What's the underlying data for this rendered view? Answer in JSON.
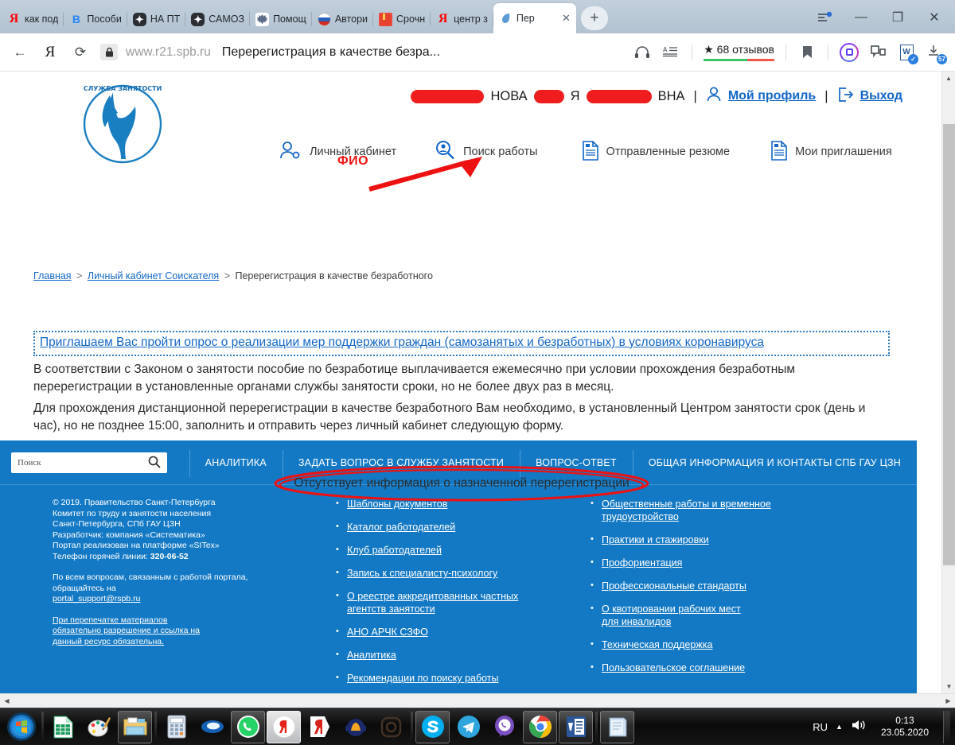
{
  "browser": {
    "tabs": [
      {
        "title": "как под",
        "favicon": "yandex-icon",
        "active": false
      },
      {
        "title": "Пособи",
        "favicon": "vk-icon",
        "active": false
      },
      {
        "title": "НА ПТ",
        "favicon": "gosuslugi-icon",
        "active": false
      },
      {
        "title": "САМОЗ",
        "favicon": "gosuslugi-icon",
        "active": false
      },
      {
        "title": "Помощ",
        "favicon": "gerb-icon",
        "active": false
      },
      {
        "title": "Автори",
        "favicon": "flag-icon",
        "active": false
      },
      {
        "title": "Срочн",
        "favicon": "book-icon",
        "active": false
      },
      {
        "title": "центр з",
        "favicon": "yandex-icon",
        "active": false
      },
      {
        "title": "Пер",
        "favicon": "browser-icon",
        "active": true
      }
    ],
    "new_tab_label": "+",
    "window_controls": {
      "sync": "sync-icon",
      "minimize": "—",
      "maximize": "❐",
      "close": "✕"
    },
    "toolbar": {
      "back": "back-arrow-icon",
      "yandex_home": "Я",
      "reload": "reload-icon",
      "lock": "lock-icon",
      "url_host": "www.r21.spb.ru",
      "url_title": "Перерегистрация в качестве безра...",
      "headphones": "headphones-icon",
      "reader": "reader-mode-icon",
      "reviews_text": "68 отзывов",
      "reviews_star": "★",
      "bookmark": "bookmark-icon",
      "alice": "alice-icon",
      "collections": "collections-icon",
      "word_badge": "word-download-icon",
      "downloads_count": "57"
    }
  },
  "site": {
    "logo_alt": "СЛУЖБА ЗАНЯТОСТИ",
    "logo_text_top": "СЛУЖБА ЗАНЯТОСТИ",
    "user": {
      "name_visible_1": "НОВА",
      "name_visible_2": "Я",
      "name_visible_3": "ВНА",
      "profile_link": "Мой профиль",
      "logout_link": "Выход",
      "profile_icon": "user-icon",
      "logout_icon": "logout-icon",
      "divider": "|"
    },
    "nav": [
      {
        "label": "Личный кабинет",
        "icon": "personal-account-icon"
      },
      {
        "label": "Поиск работы",
        "icon": "job-search-icon"
      },
      {
        "label": "Отправленные резюме",
        "icon": "document-icon"
      },
      {
        "label": "Мои приглашения",
        "icon": "document-icon"
      }
    ],
    "annotation": {
      "fio_label": "ФИО",
      "arrow": "red-arrow-annotation"
    },
    "breadcrumb": [
      {
        "label": "Главная",
        "link": true
      },
      {
        "label": "Личный кабинет Соискателя",
        "link": true
      },
      {
        "label": "Перерегистрация в качестве безработного",
        "link": false
      }
    ],
    "breadcrumb_separator": ">"
  },
  "content": {
    "survey_link": "Приглашаем Вас пройти опрос о реализации мер поддержки граждан (самозанятых и безработных) в условиях коронавируса",
    "paragraph_1": "В соответствии с Законом о занятости пособие по безработице выплачивается ежемесячно при условии прохождения безработным перерегистрации в установленные органами службы занятости сроки, но не более двух раз в месяц.",
    "paragraph_2": "Для прохождения дистанционной перерегистрации в качестве безработного Вам необходимо, в установленный Центром занятости срок (день и час), но не позднее 15:00, заполнить и отправить через личный кабинет следующую форму.",
    "notice": "Отсутствует информация о назначенной перерегистрации",
    "notice_annotation": "red-ellipse-annotation"
  },
  "footer": {
    "search_placeholder": "Поиск",
    "search_value": "",
    "search_icon": "search-icon",
    "nav": [
      "АНАЛИТИКА",
      "ЗАДАТЬ ВОПРОС В СЛУЖБУ ЗАНЯТОСТИ",
      "ВОПРОС-ОТВЕТ",
      "ОБЩАЯ ИНФОРМАЦИЯ И КОНТАКТЫ СПБ ГАУ ЦЗН"
    ],
    "about": {
      "line1": "© 2019. Правительство Санкт-Петербурга",
      "line2": "Комитет по труду и занятости населения",
      "line3": "Санкт-Петербурга, СПб ГАУ ЦЗН",
      "line4": "Разработчик: компания «Систематика»",
      "line5": "Портал реализован на платформе «SITex»",
      "phone_label": "Телефон горячей линии: ",
      "phone": "320-06-52",
      "support_line1": "По всем вопросам, связанным с работой портала,",
      "support_line2": "обращайтесь на",
      "support_email": "portal_support@rspb.ru",
      "reprint": "При перепечатке материалов обязательно разрешение и ссылка на данный ресурс обязательна."
    },
    "links_mid": [
      "Шаблоны документов",
      "Каталог работодателей",
      "Клуб работодателей",
      "Запись к специалисту-психологу",
      "О реестре аккредитованных частных агентств занятости",
      "АНО АРЧК СЗФО",
      "Аналитика",
      "Рекомендации по поиску работы"
    ],
    "links_right": [
      "Общественные работы и временное трудоустройство",
      "Практики и стажировки",
      "Профориентация",
      "Профессиональные стандарты",
      "О квотировании рабочих мест для инвалидов",
      "Техническая поддержка",
      "Пользовательское соглашение"
    ]
  },
  "taskbar": {
    "start": "windows-start-icon",
    "apps": [
      {
        "name": "excel-icon",
        "state": "pinned"
      },
      {
        "name": "paint-icon",
        "state": "pinned"
      },
      {
        "name": "explorer-icon",
        "state": "open"
      },
      {
        "name": "calculator-icon",
        "state": "pinned"
      },
      {
        "name": "browser-blue-icon",
        "state": "pinned"
      },
      {
        "name": "whatsapp-icon",
        "state": "open"
      },
      {
        "name": "yandex-browser-icon",
        "state": "focused"
      },
      {
        "name": "yandex-red-icon",
        "state": "pinned"
      },
      {
        "name": "audacity-icon",
        "state": "pinned"
      },
      {
        "name": "instagram-icon",
        "state": "pinned"
      },
      {
        "name": "skype-icon",
        "state": "open"
      },
      {
        "name": "telegram-icon",
        "state": "pinned"
      },
      {
        "name": "viber-icon",
        "state": "pinned"
      },
      {
        "name": "chrome-icon",
        "state": "open"
      },
      {
        "name": "word-icon",
        "state": "open"
      },
      {
        "name": "notepad-icon",
        "state": "open"
      }
    ],
    "tray": {
      "language": "RU",
      "show_hidden": "▲",
      "volume": "volume-icon",
      "time": "0:13",
      "date": "23.05.2020"
    }
  },
  "colors": {
    "brand_blue": "#1479c4",
    "link_blue": "#1267c7",
    "annotation_red": "#ee1111",
    "chrome_bg": "#b6c6d4"
  }
}
